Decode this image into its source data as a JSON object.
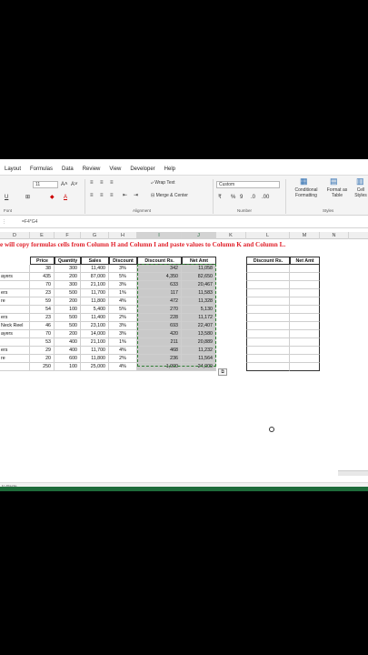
{
  "ribbon": {
    "tabs": [
      "Layout",
      "Formulas",
      "Data",
      "Review",
      "View",
      "Developer",
      "Help"
    ],
    "font_size": "11",
    "wrap_text": "Wrap Text",
    "merge_center": "Merge & Center",
    "number_format": "Custom",
    "conditional_formatting": "Conditional Formatting",
    "format_as_table": "Format as Table",
    "cell_styles": "Cell Styles",
    "groups": {
      "font": "Font",
      "alignment": "Alignment",
      "number": "Number",
      "styles": "Styles"
    }
  },
  "formula_bar": {
    "formula": "=F4*G4"
  },
  "columns": [
    "D",
    "E",
    "F",
    "G",
    "H",
    "I",
    "J",
    "K",
    "L",
    "M",
    "N"
  ],
  "title": "e will copy formulas cells from Column H and Column I and paste values to Column K and Column L.",
  "table": {
    "headers": [
      "Price",
      "Quantity",
      "Sales",
      "Discount",
      "Discount Rs.",
      "Net Amt"
    ],
    "rows": [
      {
        "a": "",
        "price": "38",
        "qty": "300",
        "sales": "11,400",
        "disc": "3%",
        "discrs": "342",
        "net": "11,058"
      },
      {
        "a": "ayers",
        "price": "435",
        "qty": "200",
        "sales": "87,000",
        "disc": "5%",
        "discrs": "4,350",
        "net": "82,650"
      },
      {
        "a": "",
        "price": "70",
        "qty": "300",
        "sales": "21,100",
        "disc": "3%",
        "discrs": "633",
        "net": "20,467"
      },
      {
        "a": "ers",
        "price": "23",
        "qty": "500",
        "sales": "11,700",
        "disc": "1%",
        "discrs": "117",
        "net": "11,583"
      },
      {
        "a": "re",
        "price": "59",
        "qty": "200",
        "sales": "11,800",
        "disc": "4%",
        "discrs": "472",
        "net": "11,328"
      },
      {
        "a": "",
        "price": "54",
        "qty": "100",
        "sales": "5,400",
        "disc": "5%",
        "discrs": "270",
        "net": "5,130"
      },
      {
        "a": "ers",
        "price": "23",
        "qty": "500",
        "sales": "11,400",
        "disc": "2%",
        "discrs": "228",
        "net": "11,172"
      },
      {
        "a": "Neck Reel",
        "price": "46",
        "qty": "500",
        "sales": "23,100",
        "disc": "3%",
        "discrs": "693",
        "net": "22,407"
      },
      {
        "a": "ayers",
        "price": "70",
        "qty": "200",
        "sales": "14,000",
        "disc": "3%",
        "discrs": "420",
        "net": "13,580"
      },
      {
        "a": "",
        "price": "53",
        "qty": "400",
        "sales": "21,100",
        "disc": "1%",
        "discrs": "211",
        "net": "20,889"
      },
      {
        "a": "ers",
        "price": "29",
        "qty": "400",
        "sales": "11,700",
        "disc": "4%",
        "discrs": "468",
        "net": "11,232"
      },
      {
        "a": "re",
        "price": "20",
        "qty": "600",
        "sales": "11,800",
        "disc": "2%",
        "discrs": "236",
        "net": "11,564"
      },
      {
        "a": "",
        "price": "250",
        "qty": "100",
        "sales": "25,000",
        "disc": "4%",
        "discrs": "1,000",
        "net": "24,000"
      }
    ]
  },
  "paste_table": {
    "headers": [
      "Discount Rs.",
      "Net Amt"
    ]
  },
  "status": "to Paste"
}
